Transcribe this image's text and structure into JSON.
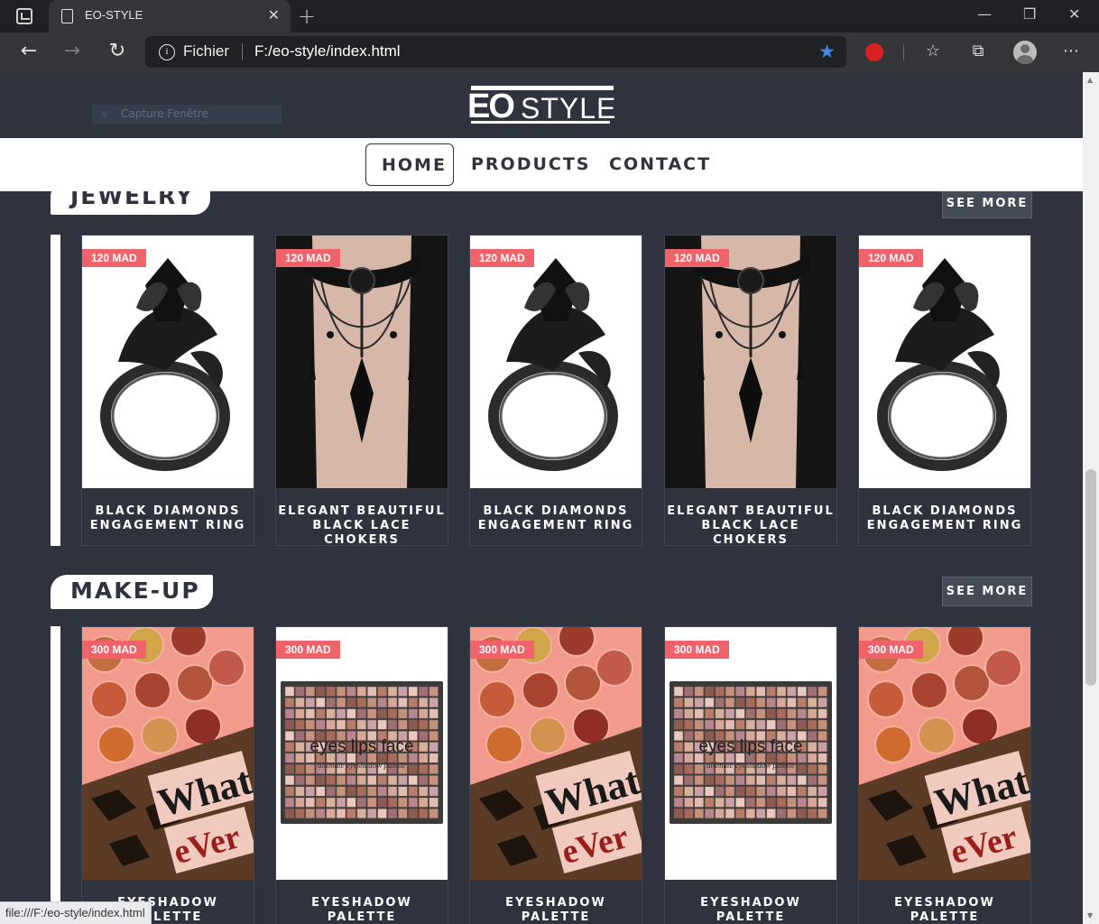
{
  "browser": {
    "tab_title": "EO-STYLE",
    "address_scheme": "Fichier",
    "address_path": "F:/eo-style/index.html",
    "status_url": "file:///F:/eo-style/index.html"
  },
  "header": {
    "overlay_label": "Capture Fenêtre",
    "logo_left": "EO",
    "logo_right": "STYLE"
  },
  "nav": {
    "items": [
      {
        "label": "HOME",
        "active": true
      },
      {
        "label": "PRODUCTS",
        "active": false
      },
      {
        "label": "CONTACT",
        "active": false
      }
    ]
  },
  "sections": [
    {
      "title": "JEWELRY",
      "see_more": "SEE MORE",
      "products": [
        {
          "price": "120 MAD",
          "name_1": "BLACK DIAMONDS",
          "name_2": "ENGAGEMENT RING",
          "image": "ring"
        },
        {
          "price": "120 MAD",
          "name_1": "ELEGANT BEAUTIFUL",
          "name_2": "BLACK LACE CHOKERS",
          "image": "choker"
        },
        {
          "price": "120 MAD",
          "name_1": "BLACK DIAMONDS",
          "name_2": "ENGAGEMENT RING",
          "image": "ring"
        },
        {
          "price": "120 MAD",
          "name_1": "ELEGANT BEAUTIFUL",
          "name_2": "BLACK LACE CHOKERS",
          "image": "choker"
        },
        {
          "price": "120 MAD",
          "name_1": "BLACK DIAMONDS",
          "name_2": "ENGAGEMENT RING",
          "image": "ring"
        }
      ]
    },
    {
      "title": "MAKE-UP",
      "see_more": "SEE MORE",
      "products": [
        {
          "price": "300 MAD",
          "name_1": "EYESHADOW PALETTE",
          "name_2": "",
          "image": "palette-whatever"
        },
        {
          "price": "300 MAD",
          "name_1": "EYESHADOW PALETTE",
          "name_2": "",
          "image": "palette-grid"
        },
        {
          "price": "300 MAD",
          "name_1": "EYESHADOW PALETTE",
          "name_2": "",
          "image": "palette-whatever"
        },
        {
          "price": "300 MAD",
          "name_1": "EYESHADOW PALETTE",
          "name_2": "",
          "image": "palette-grid"
        },
        {
          "price": "300 MAD",
          "name_1": "EYESHADOW PALETTE",
          "name_2": "",
          "image": "palette-whatever"
        }
      ]
    }
  ],
  "palette_text": {
    "brand": "eyes lips face",
    "sub": "ultimate eyeshadow palette"
  },
  "whatever_text": {
    "word1": "What",
    "word2": "eVer"
  },
  "colors": {
    "page_bg": "#2e333d",
    "price_tag": "#f1636b",
    "nav_bg": "#ffffff",
    "button_bg": "#444b57"
  }
}
